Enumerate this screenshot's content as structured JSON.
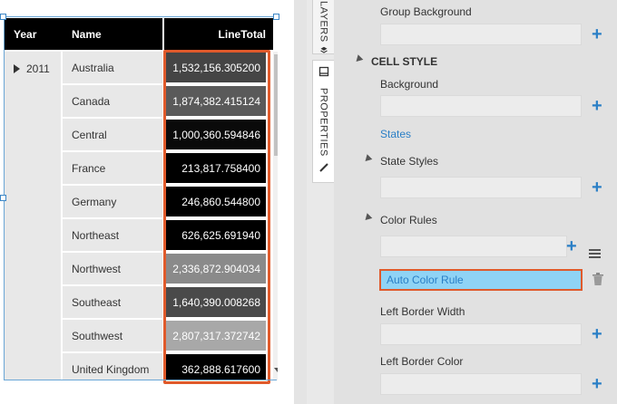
{
  "table": {
    "headers": {
      "year": "Year",
      "name": "Name",
      "total": "LineTotal"
    },
    "year_value": "2011",
    "rows": [
      {
        "name": "Australia",
        "value": "1,532,156.305200",
        "color": "#454545"
      },
      {
        "name": "Canada",
        "value": "1,874,382.415124",
        "color": "#5a5a5a"
      },
      {
        "name": "Central",
        "value": "1,000,360.594846",
        "color": "#0a0a0a"
      },
      {
        "name": "France",
        "value": "213,817.758400",
        "color": "#000000"
      },
      {
        "name": "Germany",
        "value": "246,860.544800",
        "color": "#000000"
      },
      {
        "name": "Northeast",
        "value": "626,625.691940",
        "color": "#000000"
      },
      {
        "name": "Northwest",
        "value": "2,336,872.904034",
        "color": "#8a8a8a"
      },
      {
        "name": "Southeast",
        "value": "1,640,390.008268",
        "color": "#4a4a4a"
      },
      {
        "name": "Southwest",
        "value": "2,807,317.372742",
        "color": "#a8a8a8"
      },
      {
        "name": "United Kingdom",
        "value": "362,888.617600",
        "color": "#000000"
      }
    ]
  },
  "tabs": {
    "layers": "LAYERS",
    "properties": "PROPERTIES"
  },
  "panel": {
    "group_background": "Group Background",
    "cell_style": "CELL STYLE",
    "background": "Background",
    "states_link": "States",
    "state_styles": "State Styles",
    "color_rules": "Color Rules",
    "auto_color_rule": "Auto Color Rule",
    "left_border_width": "Left Border Width",
    "left_border_color": "Left Border Color",
    "add_symbol": "+"
  },
  "icons": [
    "expand-triangle-icon",
    "layers-icon",
    "properties-icon",
    "add-icon",
    "menu-icon",
    "trash-icon",
    "collapse-triangle-icon"
  ]
}
